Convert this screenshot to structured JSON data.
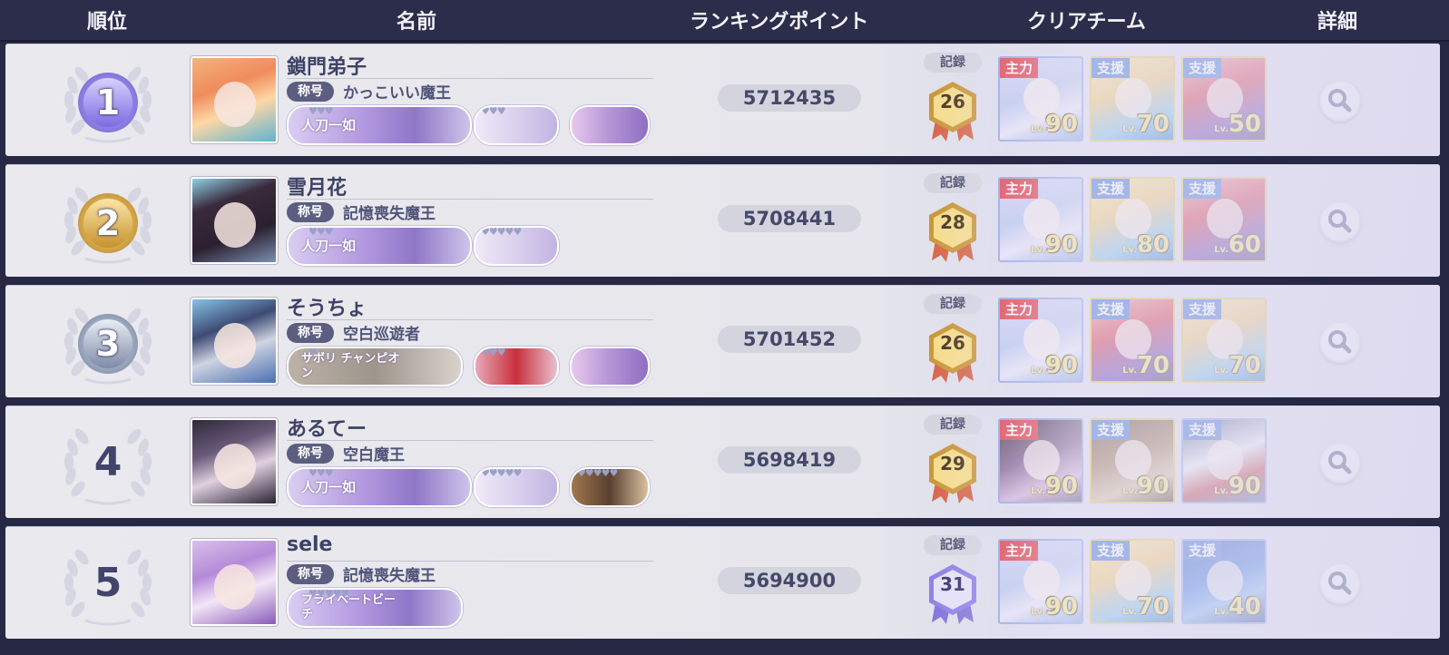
{
  "header": {
    "rank": "順位",
    "name": "名前",
    "points": "ランキングポイント",
    "team": "クリアチーム",
    "detail": "詳細"
  },
  "labels": {
    "title_badge": "称号",
    "record": "記録",
    "lv_prefix": "Lv."
  },
  "colors": {
    "header_bg": "#2b2d4a",
    "row_bg": "#e9e9ee",
    "text_main": "#3f4266",
    "role_main": "#e0323c",
    "role_support": "#3a6fd0",
    "lv_text": "#f6e27a"
  },
  "rows": [
    {
      "rank": "1",
      "medal": "silver-purple",
      "name": "鎖門弟子",
      "title": "かっこいい魔王",
      "points": "5712435",
      "record": "26",
      "record_badge": "gold",
      "chips": [
        {
          "label": "人刀一如",
          "hearts": "♥♥♥"
        },
        {
          "label": "",
          "hearts": "♥♥♥"
        },
        {
          "label": "",
          "hearts": ""
        }
      ],
      "team": [
        {
          "role": "主力",
          "lv": "90"
        },
        {
          "role": "支援",
          "lv": "70"
        },
        {
          "role": "支援",
          "lv": "50"
        }
      ]
    },
    {
      "rank": "2",
      "medal": "gold",
      "name": "雪月花",
      "title": "記憶喪失魔王",
      "points": "5708441",
      "record": "28",
      "record_badge": "gold",
      "chips": [
        {
          "label": "人刀一如",
          "hearts": "♥♥♥"
        },
        {
          "label": "",
          "hearts": "♥♥♥♥♥"
        }
      ],
      "team": [
        {
          "role": "主力",
          "lv": "90"
        },
        {
          "role": "支援",
          "lv": "80"
        },
        {
          "role": "支援",
          "lv": "60"
        }
      ]
    },
    {
      "rank": "3",
      "medal": "silver",
      "name": "そうちょ",
      "title": "空白巡遊者",
      "points": "5701452",
      "record": "26",
      "record_badge": "gold",
      "chips": [
        {
          "label": "サボリ チャンピオン",
          "hearts": "♥"
        },
        {
          "label": "",
          "hearts": "♥♥♥"
        },
        {
          "label": "",
          "hearts": ""
        }
      ],
      "team": [
        {
          "role": "主力",
          "lv": "90"
        },
        {
          "role": "支援",
          "lv": "70"
        },
        {
          "role": "支援",
          "lv": "70"
        }
      ]
    },
    {
      "rank": "4",
      "medal": "plain",
      "name": "あるてー",
      "title": "空白魔王",
      "points": "5698419",
      "record": "29",
      "record_badge": "gold",
      "chips": [
        {
          "label": "人刀一如",
          "hearts": "♥♥♥"
        },
        {
          "label": "",
          "hearts": "♥♥♥♥♥"
        },
        {
          "label": "",
          "hearts": "♥♥♥♥♥"
        }
      ],
      "team": [
        {
          "role": "主力",
          "lv": "90"
        },
        {
          "role": "支援",
          "lv": "90"
        },
        {
          "role": "支援",
          "lv": "90"
        }
      ]
    },
    {
      "rank": "5",
      "medal": "plain",
      "name": "sele",
      "title": "記憶喪失魔王",
      "points": "5694900",
      "record": "31",
      "record_badge": "purple",
      "chips": [
        {
          "label": "プライベートビーチ",
          "hearts": "♥♥♥♥♥"
        }
      ],
      "team": [
        {
          "role": "主力",
          "lv": "90"
        },
        {
          "role": "支援",
          "lv": "70"
        },
        {
          "role": "支援",
          "lv": "40"
        }
      ]
    }
  ]
}
